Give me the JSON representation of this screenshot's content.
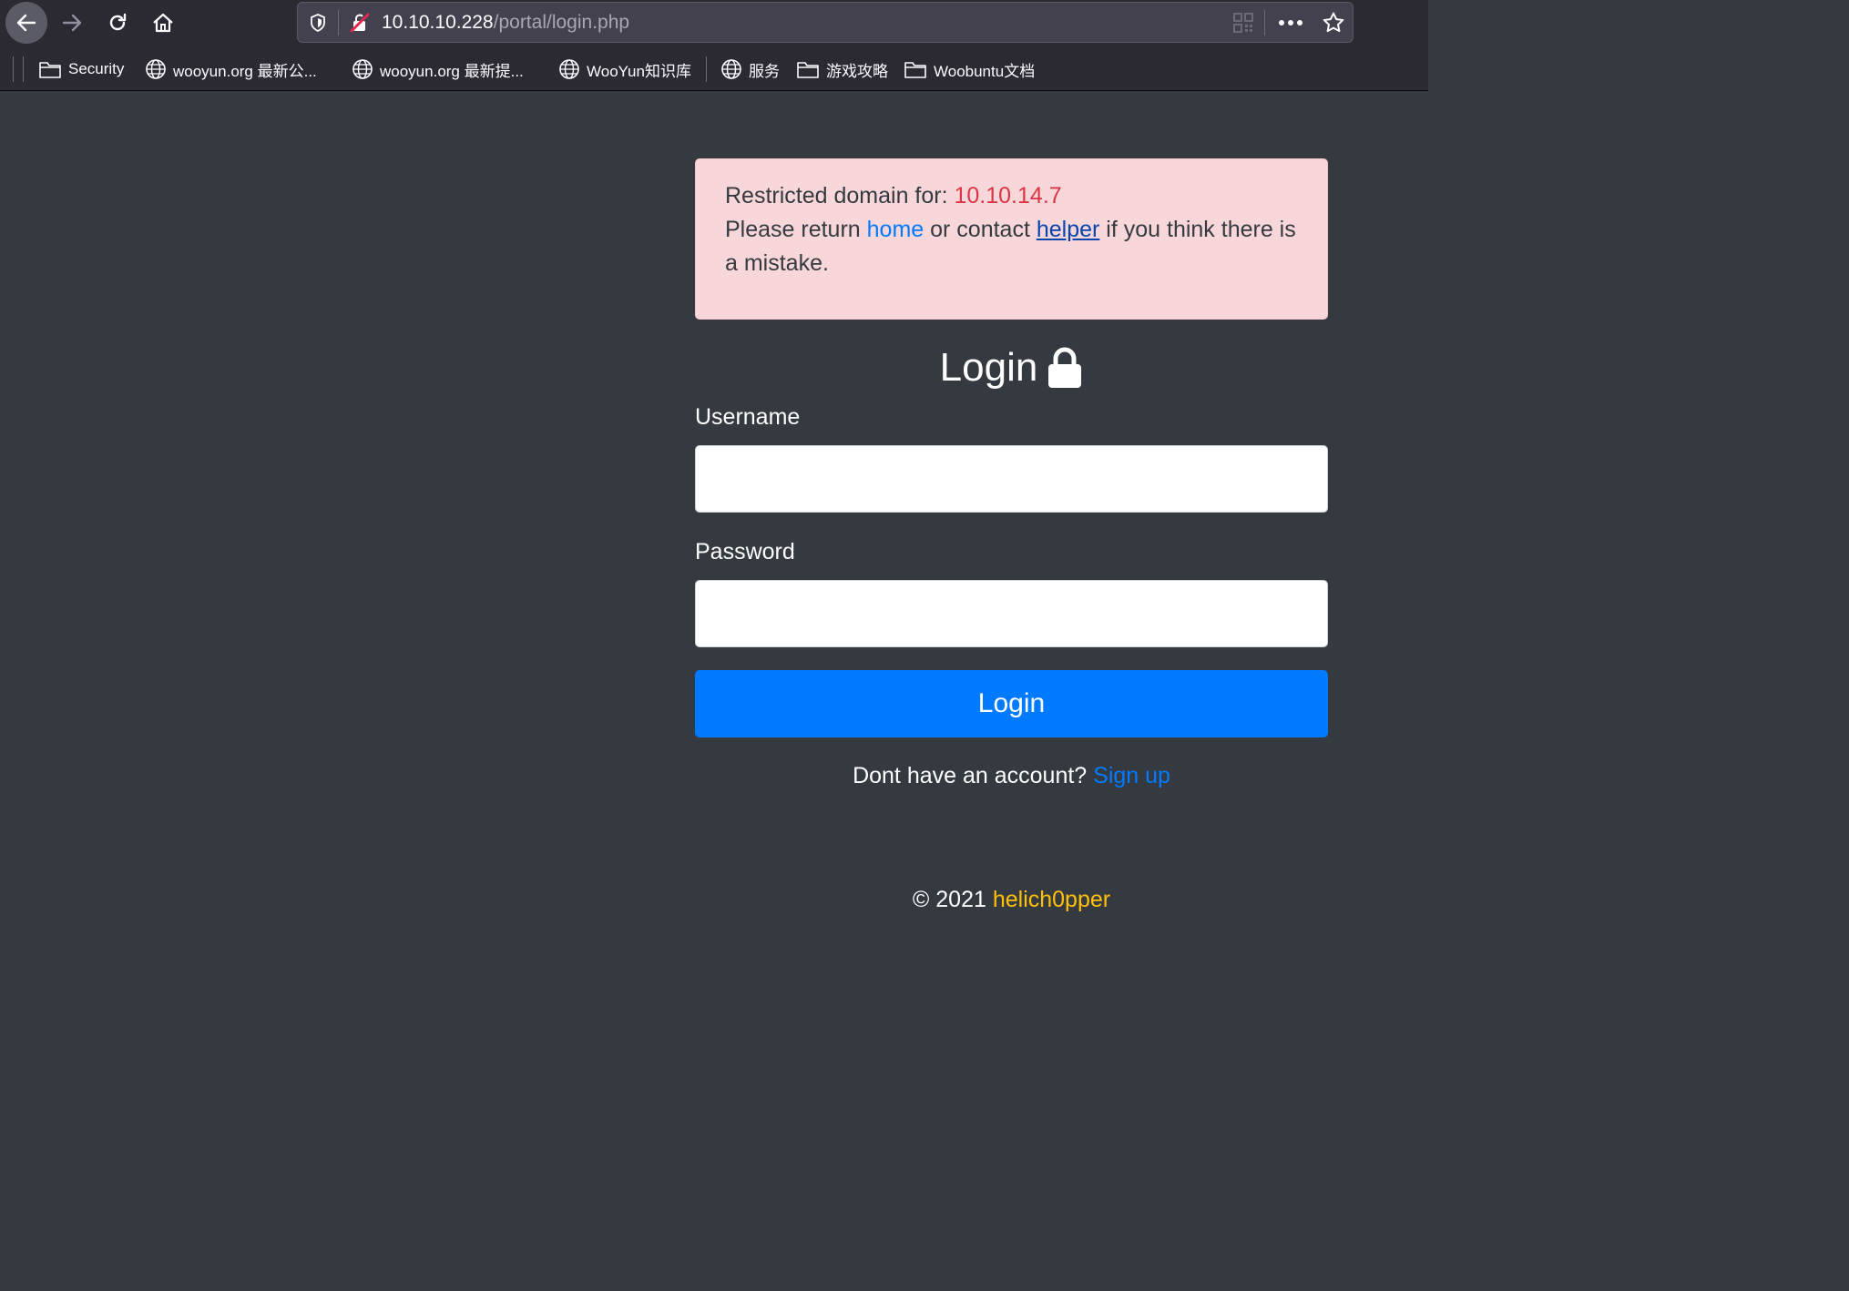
{
  "browser": {
    "url_host": "10.10.10.228",
    "url_path": "/portal/login.php",
    "bookmarks": [
      {
        "label": "Security",
        "icon": "folder-icon"
      },
      {
        "label": "wooyun.org 最新公...",
        "icon": "globe-icon"
      },
      {
        "label": "wooyun.org 最新提...",
        "icon": "globe-icon"
      },
      {
        "label": "WooYun知识库",
        "icon": "globe-icon"
      },
      {
        "label": "服务",
        "icon": "globe-icon"
      },
      {
        "label": "游戏攻略",
        "icon": "folder-icon"
      },
      {
        "label": "Woobuntu文档",
        "icon": "folder-icon"
      }
    ]
  },
  "alert": {
    "prefix": "Restricted domain for: ",
    "ip": "10.10.14.7",
    "line2_start": "Please return ",
    "home_link": "home",
    "line2_mid": " or contact ",
    "helper_link": "helper",
    "line2_end": " if you think there is a mistake."
  },
  "login": {
    "title": "Login",
    "username_label": "Username",
    "username_value": "",
    "password_label": "Password",
    "password_value": "",
    "button": "Login",
    "signup_prompt": "Dont have an account? ",
    "signup_link": "Sign up"
  },
  "footer": {
    "copyright": "© 2021 ",
    "author": "helich0pper"
  },
  "colors": {
    "page_bg": "#343a40",
    "alert_bg": "#f8d7da",
    "primary": "#007bff",
    "danger": "#dc3545",
    "warning": "#ffc107"
  }
}
